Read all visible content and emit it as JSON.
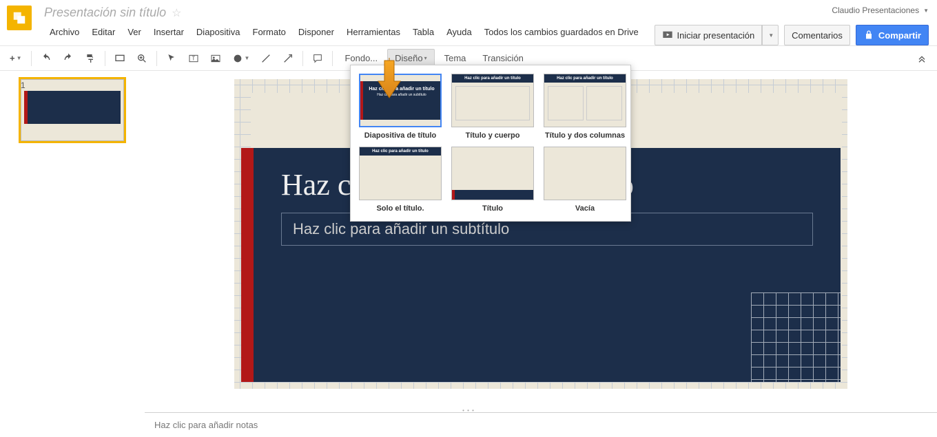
{
  "header": {
    "doc_title": "Presentación sin título",
    "account": "Claudio Presentaciones",
    "present_btn": "Iniciar presentación",
    "comments_btn": "Comentarios",
    "share_btn": "Compartir"
  },
  "menubar": {
    "file": "Archivo",
    "edit": "Editar",
    "view": "Ver",
    "insert": "Insertar",
    "slide": "Diapositiva",
    "format": "Formato",
    "arrange": "Disponer",
    "tools": "Herramientas",
    "table": "Tabla",
    "help": "Ayuda",
    "save_status": "Todos los cambios guardados en Drive"
  },
  "toolbar": {
    "background": "Fondo...",
    "layout": "Diseño",
    "theme": "Tema",
    "transition": "Transición"
  },
  "sidebar": {
    "slide_num": "1"
  },
  "slide": {
    "title": "Haz clic para añadir un título",
    "subtitle": "Haz clic para añadir un subtítulo"
  },
  "notes": {
    "placeholder": "Haz clic para añadir notas"
  },
  "layouts": {
    "title_slide": "Diapositiva de título",
    "title_body": "Título y cuerpo",
    "two_col": "Título y dos columnas",
    "title_only": "Solo el título.",
    "title": "Título",
    "blank": "Vacía",
    "preview_text": "Haz clic para añadir un título",
    "preview_sub": "Haz clic para añadir un subtítulo"
  }
}
